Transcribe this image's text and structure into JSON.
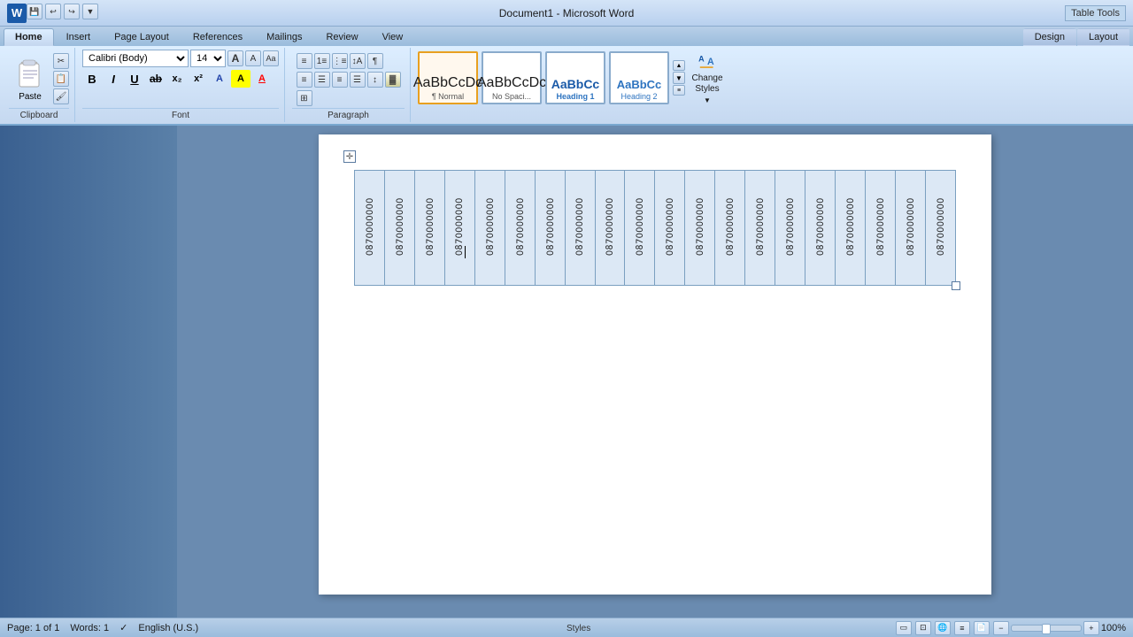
{
  "titleBar": {
    "title": "Document1 - Microsoft Word",
    "tableTools": "Table Tools"
  },
  "tabs": {
    "items": [
      "Home",
      "Insert",
      "Page Layout",
      "References",
      "Mailings",
      "Review",
      "View"
    ],
    "active": "Home",
    "extraTabs": [
      "Design",
      "Layout"
    ],
    "extraTabsGroup": "Table Tools"
  },
  "ribbonGroups": {
    "clipboard": {
      "label": "Clipboard",
      "paste": "Paste"
    },
    "font": {
      "label": "Font",
      "fontName": "Calibri (Body)",
      "fontSize": "14"
    },
    "paragraph": {
      "label": "Paragraph"
    },
    "styles": {
      "label": "Styles",
      "items": [
        {
          "name": "Normal",
          "preview": "AaBbCcDc",
          "label": "Normal",
          "selected": false
        },
        {
          "name": "NoSpacing",
          "preview": "AaBbCcDc",
          "label": "No Spaci...",
          "selected": false
        },
        {
          "name": "Heading1",
          "preview": "AaBbCc",
          "label": "Heading 1",
          "selected": false
        },
        {
          "name": "Heading2",
          "preview": "AaBbCc",
          "label": "Heading 2",
          "selected": false
        }
      ],
      "changeStylesLabel": "Change\nStyles"
    }
  },
  "document": {
    "cellValue": "0870000000",
    "cellCount": 20
  },
  "statusBar": {
    "page": "Page: 1 of 1",
    "words": "Words: 1",
    "language": "English (U.S.)",
    "zoom": "100%"
  }
}
